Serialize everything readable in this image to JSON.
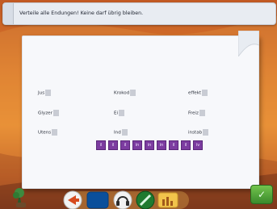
{
  "instruction": "Verteile alle Endungen! Keine darf übrig bleiben.",
  "words": [
    {
      "text": "Jus"
    },
    {
      "text": "Krokod"
    },
    {
      "text": "effekt"
    },
    {
      "text": "Glyzer"
    },
    {
      "text": "Ei"
    },
    {
      "text": "Freiz"
    },
    {
      "text": "Utens"
    },
    {
      "text": "Ind"
    },
    {
      "text": "instab"
    }
  ],
  "tiles": [
    "il",
    "il",
    "il",
    "in",
    "in",
    "in",
    "il",
    "il",
    "iv"
  ],
  "colors": {
    "accent": "#7c3ca0",
    "paper": "#f7f8fb",
    "background": "#dd7a2c",
    "topbar": "#e8ecf2"
  },
  "icons": {
    "left": "plant-icon",
    "toolbar": [
      "arrow-icon",
      "book-icon",
      "headphones-icon",
      "pen-icon",
      "chart-icon"
    ],
    "right": "check-icon"
  }
}
